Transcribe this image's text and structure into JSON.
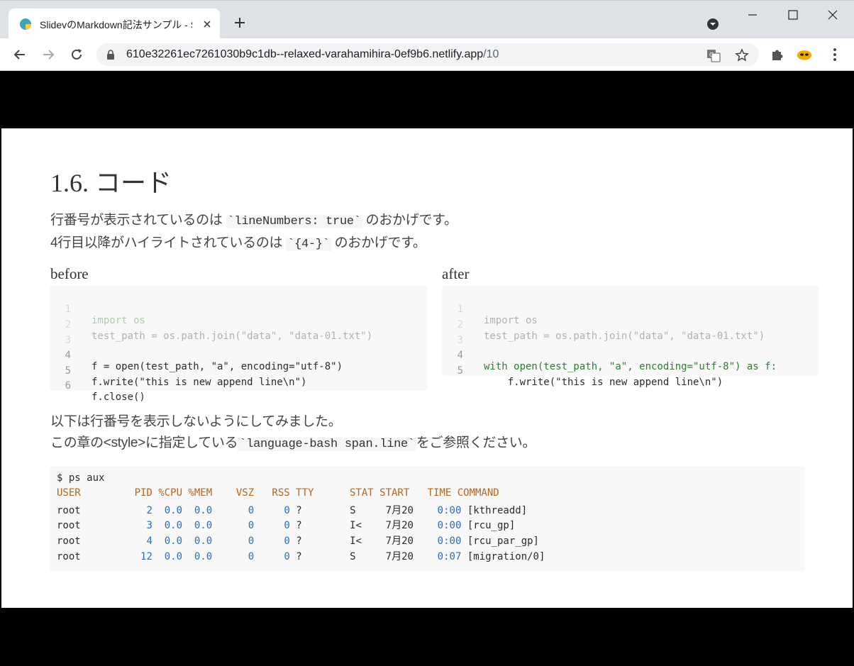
{
  "browser": {
    "tab_title": "SlidevのMarkdown記法サンプル - S",
    "url_host": "610e32261ec7261030b9c1db--relaxed-varahamihira-0ef9b6.netlify.app",
    "url_path": "/10"
  },
  "slide": {
    "heading": "1.6. コード",
    "line1_pre": "行番号が表示されているのは",
    "line1_code": "`lineNumbers: true`",
    "line1_post": "のおかげです。",
    "line2_pre": "4行目以降がハイライトされているのは",
    "line2_code": "`{4-}`",
    "line2_post": "のおかげです。",
    "before_label": "before",
    "after_label": "after",
    "before_code": [
      {
        "n": "1",
        "text": "import os"
      },
      {
        "n": "2",
        "text": "test_path = os.path.join(\"data\", \"data-01.txt\")"
      },
      {
        "n": "3",
        "text": ""
      },
      {
        "n": "4",
        "text": "f = open(test_path, \"a\", encoding=\"utf-8\")"
      },
      {
        "n": "5",
        "text": "f.write(\"this is new append line\\n\")"
      },
      {
        "n": "6",
        "text": "f.close()"
      }
    ],
    "after_code": [
      {
        "n": "1",
        "text": "import os"
      },
      {
        "n": "2",
        "text": "test_path = os.path.join(\"data\", \"data-01.txt\")"
      },
      {
        "n": "3",
        "text": ""
      },
      {
        "n": "4",
        "text": "with open(test_path, \"a\", encoding=\"utf-8\") as f:"
      },
      {
        "n": "5",
        "text": "    f.write(\"this is new append line\\n\")"
      }
    ],
    "line3": "以下は行番号を表示しないようにしてみました。",
    "line4_pre": "この章の<style>に指定している",
    "line4_code": "`language-bash span.line`",
    "line4_post": "をご参照ください。",
    "bash_prompt": "$ ps aux",
    "bash_header": "USER         PID %CPU %MEM    VSZ   RSS TTY      STAT START   TIME COMMAND",
    "bash_rows": [
      {
        "user": "root",
        "pid": "2",
        "cpu": "0.0",
        "mem": "0.0",
        "vsz": "0",
        "rss": "0",
        "tty": "?",
        "stat": "S",
        "start": "7月20",
        "time": "0:00",
        "cmd": "[kthreadd]"
      },
      {
        "user": "root",
        "pid": "3",
        "cpu": "0.0",
        "mem": "0.0",
        "vsz": "0",
        "rss": "0",
        "tty": "?",
        "stat": "I<",
        "start": "7月20",
        "time": "0:00",
        "cmd": "[rcu_gp]"
      },
      {
        "user": "root",
        "pid": "4",
        "cpu": "0.0",
        "mem": "0.0",
        "vsz": "0",
        "rss": "0",
        "tty": "?",
        "stat": "I<",
        "start": "7月20",
        "time": "0:00",
        "cmd": "[rcu_par_gp]"
      },
      {
        "user": "root",
        "pid": "12",
        "cpu": "0.0",
        "mem": "0.0",
        "vsz": "0",
        "rss": "0",
        "tty": "?",
        "stat": "S",
        "start": "7月20",
        "time": "0:07",
        "cmd": "[migration/0]"
      }
    ]
  }
}
